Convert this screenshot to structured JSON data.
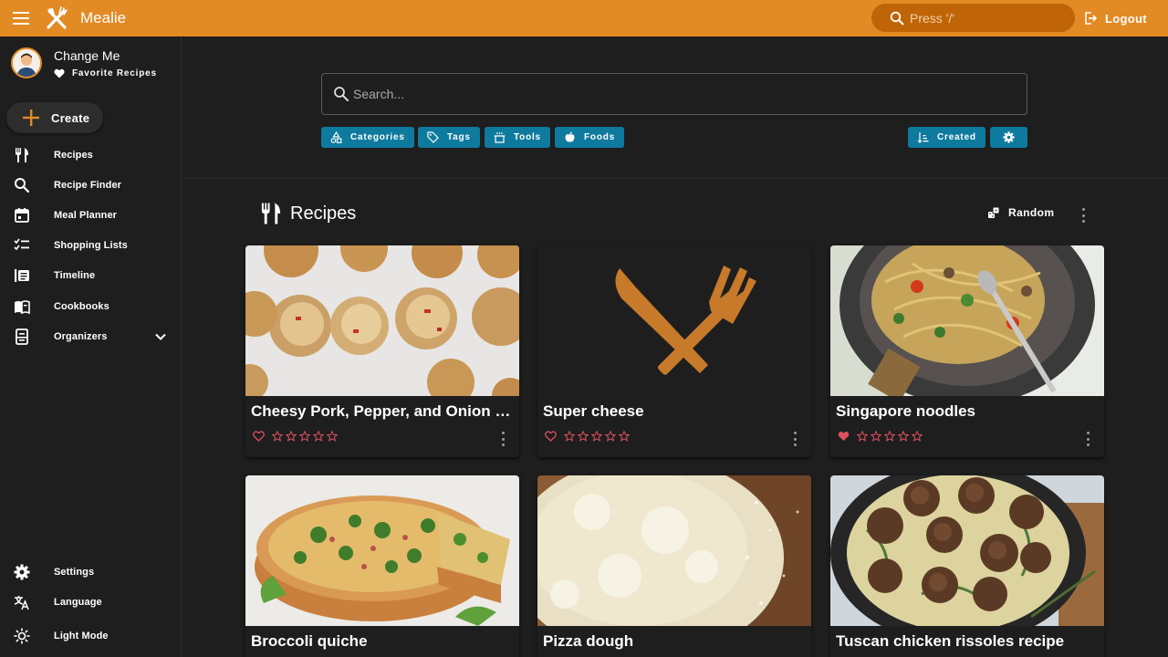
{
  "app": {
    "name": "Mealie"
  },
  "topbar": {
    "search_placeholder": "Press '/'",
    "logout_label": "Logout"
  },
  "user": {
    "name": "Change Me",
    "favorites_label": "Favorite Recipes"
  },
  "sidebar": {
    "create_label": "Create",
    "items": [
      {
        "label": "Recipes",
        "icon": "fork-knife-icon"
      },
      {
        "label": "Recipe Finder",
        "icon": "search-icon"
      },
      {
        "label": "Meal Planner",
        "icon": "calendar-icon"
      },
      {
        "label": "Shopping Lists",
        "icon": "checklist-icon"
      },
      {
        "label": "Timeline",
        "icon": "timeline-icon"
      },
      {
        "label": "Cookbooks",
        "icon": "book-icon"
      },
      {
        "label": "Organizers",
        "icon": "organizer-icon"
      }
    ],
    "bottom_items": [
      {
        "label": "Settings",
        "icon": "gear-icon"
      },
      {
        "label": "Language",
        "icon": "translate-icon"
      },
      {
        "label": "Light Mode",
        "icon": "sun-icon"
      }
    ]
  },
  "search": {
    "placeholder": "Search...",
    "filters": [
      "Categories",
      "Tags",
      "Tools",
      "Foods"
    ],
    "sort_label": "Created"
  },
  "recipes_section": {
    "title": "Recipes",
    "random_label": "Random",
    "cards": [
      {
        "title": "Cheesy Pork, Pepper, and Onion Bre...",
        "favorite": false,
        "rating": 0
      },
      {
        "title": "Super cheese",
        "favorite": false,
        "rating": 0
      },
      {
        "title": "Singapore noodles",
        "favorite": true,
        "rating": 0
      },
      {
        "title": "Broccoli quiche"
      },
      {
        "title": "Pizza dough"
      },
      {
        "title": "Tuscan chicken rissoles recipe"
      }
    ]
  },
  "colors": {
    "accent": "#e28a24",
    "chip": "#0e7a9e",
    "heart": "#e0515f",
    "background": "#1e1e1e"
  }
}
